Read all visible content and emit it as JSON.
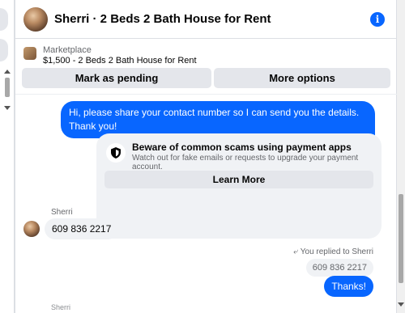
{
  "header": {
    "title": "Sherri · 2 Beds 2 Bath House for Rent",
    "info_icon": "info-icon"
  },
  "listing": {
    "source": "Marketplace",
    "item": "$1,500 - 2 Beds 2 Bath House for Rent",
    "mark_pending_label": "Mark as pending",
    "more_options_label": "More options"
  },
  "messages": {
    "outgoing_1": "Hi, please share your contact number so I can send you the details. Thank you!",
    "scam_card": {
      "title": "Beware of common scams using payment apps",
      "description": "Watch out for fake emails or requests to upgrade your payment account.",
      "learn_more_label": "Learn More"
    },
    "sender_name": "Sherri",
    "incoming_1": "609 836 2217",
    "replied_label": "You replied to Sherri",
    "quoted_text": "609 836 2217",
    "outgoing_2": "Thanks!",
    "cut_sender": "Sherri"
  },
  "colors": {
    "accent": "#0866ff",
    "bubble_incoming": "#f0f2f5",
    "button_bg": "#e4e6eb",
    "secondary_text": "#65676b"
  }
}
